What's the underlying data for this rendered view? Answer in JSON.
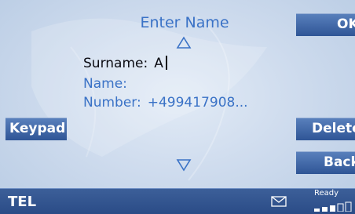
{
  "header": {
    "title": "Enter Name"
  },
  "fields": {
    "surname": {
      "label": "Surname:",
      "value": "A"
    },
    "name": {
      "label": "Name:",
      "value": ""
    },
    "number": {
      "label": "Number:",
      "value": "+499417908..."
    }
  },
  "buttons": {
    "ok": "OK",
    "keypad": "Keypad",
    "delete": "Delete",
    "back": "Back"
  },
  "status": {
    "mode": "TEL",
    "ready": "Ready",
    "signal_bars": 3,
    "signal_total": 5
  },
  "colors": {
    "accent_text": "#3a72c6",
    "button": "#3d64a6",
    "status_bar": "#2f518c"
  },
  "icons": [
    "arrow-up-icon",
    "arrow-down-icon",
    "envelope-icon",
    "signal-strength-icon"
  ]
}
